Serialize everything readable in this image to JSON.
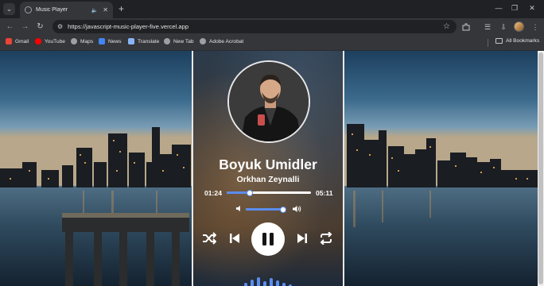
{
  "browser": {
    "tab": {
      "title": "Music Player"
    },
    "url": "https://javascript-music-player-five.vercel.app",
    "bookmarks": [
      {
        "label": "Gmail",
        "color": "#ea4335"
      },
      {
        "label": "YouTube",
        "color": "#ff0000"
      },
      {
        "label": "Maps",
        "color": "#9aa0a6"
      },
      {
        "label": "News",
        "color": "#4285f4"
      },
      {
        "label": "Translate",
        "color": "#8ab4f8"
      },
      {
        "label": "New Tab",
        "color": "#9aa0a6"
      },
      {
        "label": "Adobe Acrobat",
        "color": "#9aa0a6"
      }
    ],
    "all_bookmarks": "All Bookmarks"
  },
  "player": {
    "song_title": "Boyuk Umidler",
    "artist": "Orkhan Zeynalli",
    "current_time": "01:24",
    "duration": "05:11",
    "progress": 0.27,
    "volume": 0.94,
    "accent": "#5b8def",
    "playing": true
  }
}
